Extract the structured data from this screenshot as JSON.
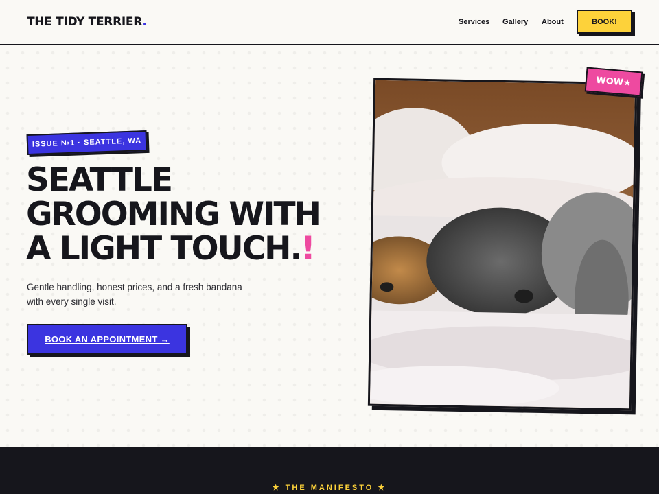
{
  "brand": {
    "name": "THE TIDY TERRIER",
    "dot": "."
  },
  "nav": {
    "links": [
      "Services",
      "Gallery",
      "About"
    ],
    "book_label": "BOOK!"
  },
  "hero": {
    "badge": "ISSUE №1 · SEATTLE, WA",
    "headline_lines": [
      "SEATTLE",
      "GROOMING WITH",
      "A LIGHT TOUCH."
    ],
    "headline_accent": "!",
    "subtitle": "Gentle handling, honest prices, and a fresh bandana with every single visit.",
    "cta_label": "BOOK AN APPOINTMENT →"
  },
  "photo": {
    "sticker": "WOW★"
  },
  "manifesto": {
    "label": "★ THE MANIFESTO ★"
  },
  "colors": {
    "ink": "#16161c",
    "accent_blue": "#3b34e0",
    "accent_yellow": "#fdd23a",
    "accent_pink": "#ee4aa0",
    "paper": "#faf9f5"
  }
}
